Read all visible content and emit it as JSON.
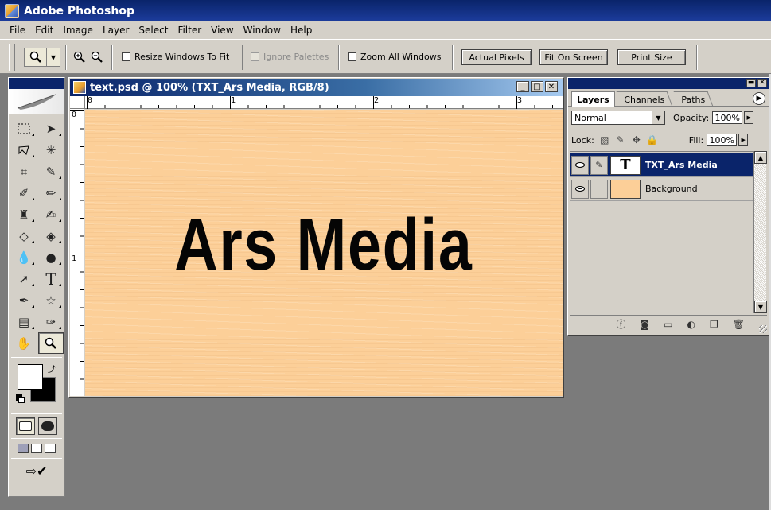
{
  "app": {
    "title": "Adobe Photoshop"
  },
  "menu": [
    "File",
    "Edit",
    "Image",
    "Layer",
    "Select",
    "Filter",
    "View",
    "Window",
    "Help"
  ],
  "options": {
    "tool_icon": "magnifier-icon",
    "zoom_in_icon": "zoom-in-icon",
    "zoom_out_icon": "zoom-out-icon",
    "resize_windows": "Resize Windows To Fit",
    "ignore_palettes": "Ignore Palettes",
    "zoom_all_windows": "Zoom All Windows",
    "actual_pixels": "Actual Pixels",
    "fit_on_screen": "Fit On Screen",
    "print_size": "Print Size"
  },
  "document": {
    "title": "text.psd @ 100% (TXT_Ars Media, RGB/8)",
    "canvas_text": "Ars Media",
    "canvas_color": "#fccf98",
    "ruler_h": [
      "0",
      "1",
      "2",
      "3"
    ],
    "ruler_v": [
      "0",
      "1"
    ],
    "win_min": "_",
    "win_max": "□",
    "win_close": "✕"
  },
  "layers_panel": {
    "tabs": [
      "Layers",
      "Channels",
      "Paths"
    ],
    "blend_mode": "Normal",
    "opacity_label": "Opacity:",
    "opacity_value": "100%",
    "lock_label": "Lock:",
    "fill_label": "Fill:",
    "fill_value": "100%",
    "layers": [
      {
        "name": "TXT_Ars Media",
        "thumb": "T",
        "selected": true
      },
      {
        "name": "Background",
        "thumb": "",
        "selected": false
      }
    ],
    "footer_icons": [
      "layer-style-icon",
      "mask-icon",
      "folder-icon",
      "adjustment-icon",
      "new-layer-icon",
      "trash-icon"
    ]
  },
  "colors": {
    "titlebar": "#0a246a",
    "chrome": "#d4d0c8",
    "workspace": "#7b7b7b",
    "foreground": "#ffffff",
    "background": "#000000"
  }
}
